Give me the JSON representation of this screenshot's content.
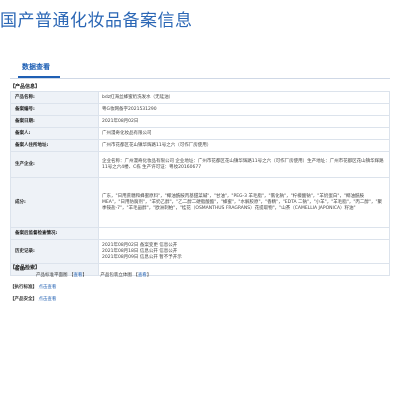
{
  "header": {
    "title": "国产普通化妆品备案信息"
  },
  "tabs": [
    {
      "label": "数据查看"
    }
  ],
  "product_info": {
    "section_title": "【产品信息】",
    "rows": [
      {
        "label": "产品名称:",
        "value": "bdz红海丝蜂蜜奶洗发水（无硅油）"
      },
      {
        "label": "备案编号:",
        "value": "粤G妆网备字2021531290"
      },
      {
        "label": "备案日期:",
        "value": "2021年08月02日"
      },
      {
        "label": "备案人:",
        "value": "广州漫奇化妆品有限公司"
      },
      {
        "label": "备案人住所地址:",
        "value": "广州市花都区花山镇华辉路11号之六（可作厂房使用）"
      },
      {
        "label": "生产企业:",
        "value": "企业名称：广州漫奇化妆品有限公司 企业地址：广州市花都区花山镇华辉路11号之六（可作厂房使用）生产地址：广州市花都区花山镇华辉路11号之六4楼、C栋 生产许可证：粤妆20160677"
      },
      {
        "label": "成分:",
        "value": "广东，\"日用蔗糖和蜂蜜原料\"，\"椰油酰胺丙基甜菜碱\"，\"甘油\"，\"PEG-3 羊毛脂\"，\"氯化钠\"，\"柠檬酸钠\"，\"羊奶蛋白\"，\"椰油酰胺MEA\"，\"日用防腐剂\"，\"羊奶乙醇\"，\"乙二醇二硬脂酸酯\"，\"蜂蜜\"，\"水解胶原\"，\"香精\"，\"EDTA 二钠\"，\"小羊\"，\"羊毛脂\"，\"丙二醇\"，\"聚季铵盐-7\"，\"羊毛甾醇\"，\"欧洲刺柏\"，\"桂花（OSMANTHUS FRAGRANS）花提取物\"，\"山茶（CAMELLIA JAPONICA）籽油\""
      },
      {
        "label": "备案后监督检查情况:",
        "value": ""
      },
      {
        "label": "历史记录:",
        "value": "2021年08月02日 备案变更 信息公开\n2021年08月18日 信息公开 信息公开\n2021年08月09日 信息公开 暂不予开示"
      },
      {
        "label": "备注:",
        "value": ""
      }
    ]
  },
  "product_check": {
    "section_title": "【产品检索】",
    "label_a": "产品标准平面图",
    "label_b": "产品包装立体图",
    "view_link": "查看"
  },
  "executive_standard": {
    "section_title": "【执行标准】",
    "link": "点击查看"
  },
  "product_safety": {
    "section_title": "【产品安全】",
    "link": "点击查看"
  }
}
